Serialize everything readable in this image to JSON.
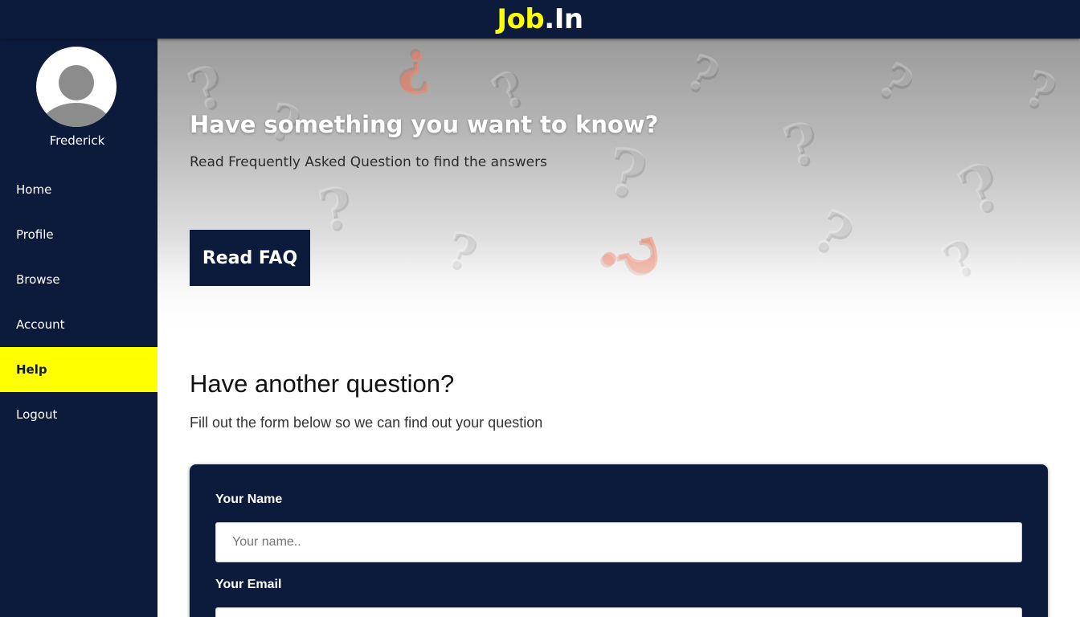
{
  "header": {
    "brand_job": "Job",
    "brand_in": ".In"
  },
  "sidebar": {
    "username": "Frederick",
    "items": [
      {
        "label": "Home"
      },
      {
        "label": "Profile"
      },
      {
        "label": "Browse"
      },
      {
        "label": "Account"
      },
      {
        "label": "Help",
        "active": true
      },
      {
        "label": "Logout"
      }
    ]
  },
  "hero": {
    "title": "Have something you want to know?",
    "subtitle": "Read Frequently Asked Question to find the answers",
    "button_label": "Read FAQ"
  },
  "question_section": {
    "title": "Have another question?",
    "subtitle": "Fill out the form below so we can find out your question"
  },
  "form": {
    "name_label": "Your Name",
    "name_placeholder": "Your name..",
    "email_label": "Your Email"
  },
  "colors": {
    "navy": "#0c1a3c",
    "accent_yellow": "#ffff00"
  }
}
